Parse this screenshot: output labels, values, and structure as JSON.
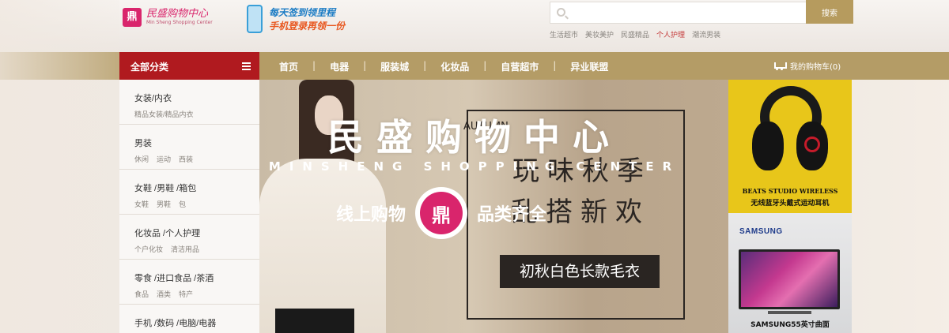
{
  "header": {
    "logo_cn": "民盛购物中心",
    "logo_en": "Min Sheng Shopping Center",
    "promo_line1": "每天签到领里程",
    "promo_line2_a": "手机登录",
    "promo_line2_b": "再领一份",
    "search_placeholder": "",
    "search_button": "搜索",
    "hotwords": [
      "生活超市",
      "美妆美护",
      "民盛精品",
      "个人护理",
      "潮流男装"
    ],
    "hotword_active_index": 3
  },
  "nav": {
    "all_categories": "全部分类",
    "links": [
      "首页",
      "电器",
      "服装城",
      "化妆品",
      "自营超市",
      "异业联盟"
    ],
    "cart": "我的购物车(0)"
  },
  "sidebar": {
    "categories": [
      {
        "title": "女装/内衣",
        "subs": [
          "精品女装/精品内衣"
        ]
      },
      {
        "title": "男装",
        "subs": [
          "休闲",
          "运动",
          "西装"
        ]
      },
      {
        "title": "女鞋 /男鞋 /箱包",
        "subs": [
          "女鞋",
          "男鞋",
          "包"
        ]
      },
      {
        "title": "化妆品 /个人护理",
        "subs": [
          "个户化妆",
          "清洁用品"
        ]
      },
      {
        "title": "零食 /进口食品 /茶酒",
        "subs": [
          "食品",
          "酒类",
          "特产"
        ]
      },
      {
        "title": "手机 /数码 /电脑/电器",
        "subs": []
      }
    ]
  },
  "banner": {
    "title_cn": "民盛购物中心",
    "title_en": "MINSHENG SHOPPING CENTER",
    "tagline_left": "线上购物",
    "tagline_right": "品类齐全",
    "logo_glyph": "鼎",
    "frame_line1": "玩味秋季",
    "frame_line2": "乱搭新欢",
    "frame_vertical": "AUTUMN",
    "product_tag": "初秋白色长款毛衣"
  },
  "ads": {
    "ad1_title": "BEATS STUDIO WIRELESS",
    "ad1_sub": "无线蓝牙头戴式运动耳机",
    "ad2_brand": "SAMSUNG",
    "ad2_caption": "SAMSUNG55英寸曲面"
  },
  "colors": {
    "brand_pink": "#d9256c",
    "nav_gold": "#b49c66",
    "category_red": "#b01a1f",
    "ad_yellow": "#e8c61a"
  }
}
